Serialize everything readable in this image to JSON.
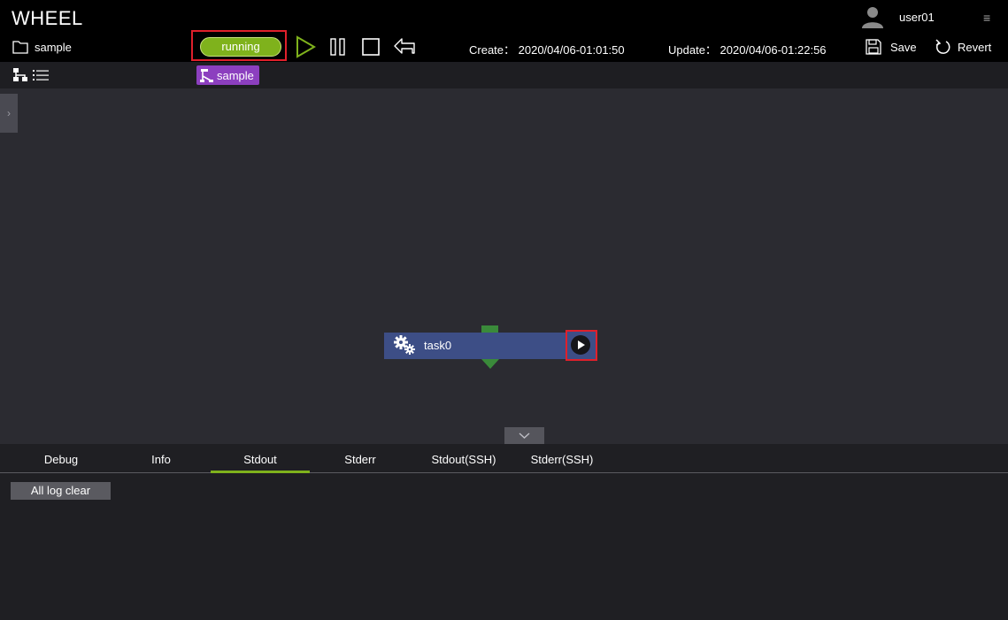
{
  "app": {
    "title": "WHEEL"
  },
  "user": {
    "name": "user01"
  },
  "project": {
    "name": "sample",
    "status": "running"
  },
  "timestamps": {
    "create": "Create： 2020/04/06-01:01:50",
    "update": "Update： 2020/04/06-01:22:56"
  },
  "actions": {
    "save": "Save",
    "revert": "Revert"
  },
  "breadcrumb": {
    "label": "sample"
  },
  "task": {
    "name": "task0"
  },
  "tabs": [
    {
      "label": "Debug"
    },
    {
      "label": "Info"
    },
    {
      "label": "Stdout"
    },
    {
      "label": "Stderr"
    },
    {
      "label": "Stdout(SSH)"
    },
    {
      "label": "Stderr(SSH)"
    }
  ],
  "active_tab": "Stdout",
  "log": {
    "clear_label": "All log clear"
  },
  "icons": {
    "menu": "≡",
    "side_toggle": "›"
  },
  "colors": {
    "status_running": "#7fb21c",
    "accent_green": "#7fb21c",
    "task_node": "#3d4e86",
    "breadcrumb_chip": "#8c3fbf",
    "highlight": "#e0202b"
  }
}
